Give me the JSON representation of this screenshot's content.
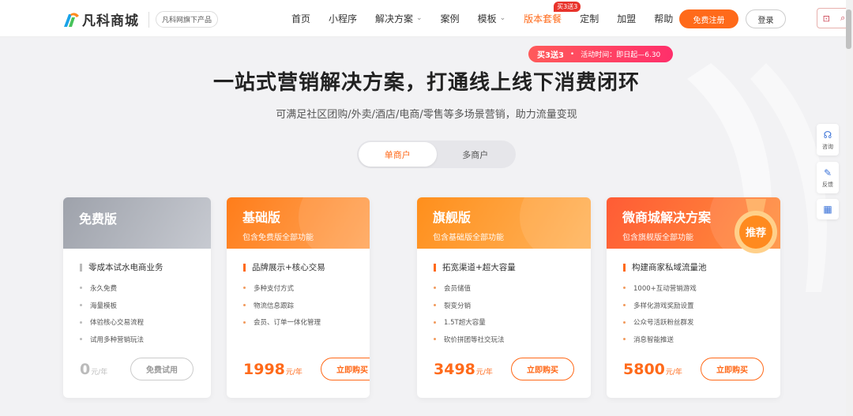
{
  "header": {
    "logo_text": "凡科商城",
    "sub_badge": "凡科网旗下产品",
    "nav": [
      {
        "label": "首页"
      },
      {
        "label": "小程序"
      },
      {
        "label": "解决方案",
        "caret": "⌄"
      },
      {
        "label": "案例"
      },
      {
        "label": "模板",
        "caret": "⌄"
      },
      {
        "label": "版本套餐",
        "tag": "买3送3",
        "active": true
      },
      {
        "label": "定制"
      },
      {
        "label": "加盟"
      },
      {
        "label": "帮助"
      }
    ],
    "register_label": "免费注册",
    "login_label": "登录"
  },
  "promo": {
    "bold": "买3送3",
    "dot": "•",
    "text": "活动时间：即日起—6.30"
  },
  "hero": {
    "title": "一站式营销解决方案，打通线上线下消费闭环",
    "subtitle": "可满足社区团购/外卖/酒店/电商/零售等多场景营销，助力流量变现"
  },
  "tabs": [
    {
      "label": "单商户",
      "active": true
    },
    {
      "label": "多商户",
      "active": false
    }
  ],
  "plans": [
    {
      "name": "免费版",
      "desc": "",
      "main": "零成本试水电商业务",
      "features": [
        "永久免费",
        "海量模板",
        "体验核心交易流程",
        "试用多种营销玩法"
      ],
      "price": "0",
      "unit": "元/年",
      "button": "免费试用"
    },
    {
      "name": "基础版",
      "desc": "包含免费版全部功能",
      "main": "品牌展示+核心交易",
      "features": [
        "多种支付方式",
        "物流信息跟踪",
        "会员、订单一体化管理"
      ],
      "price": "1998",
      "unit": "元/年",
      "button": "立即购买"
    },
    {
      "name": "旗舰版",
      "desc": "包含基础版全部功能",
      "main": "拓宽渠道+超大容量",
      "features": [
        "会员储值",
        "裂变分销",
        "1.5T超大容量",
        "砍价拼团等社交玩法"
      ],
      "price": "3498",
      "unit": "元/年",
      "button": "立即购买"
    },
    {
      "name": "微商城解决方案",
      "desc": "包含旗舰版全部功能",
      "main": "构建商家私域流量池",
      "features": [
        "1000+互动营销游戏",
        "多样化游戏奖励设置",
        "公众号活跃粉丝群发",
        "消息智能推送"
      ],
      "price": "5800",
      "unit": "元/年",
      "button": "立即购买",
      "badge": "推荐"
    }
  ],
  "side_tools": [
    {
      "icon": "headset-icon",
      "label": "咨询"
    },
    {
      "icon": "pencil-icon",
      "label": "反馈"
    },
    {
      "icon": "qrcode-icon",
      "label": ""
    }
  ],
  "colors": {
    "accent": "#ff6a1a",
    "promo": "#ff3b5c",
    "gray_head": "#a9adb5"
  }
}
